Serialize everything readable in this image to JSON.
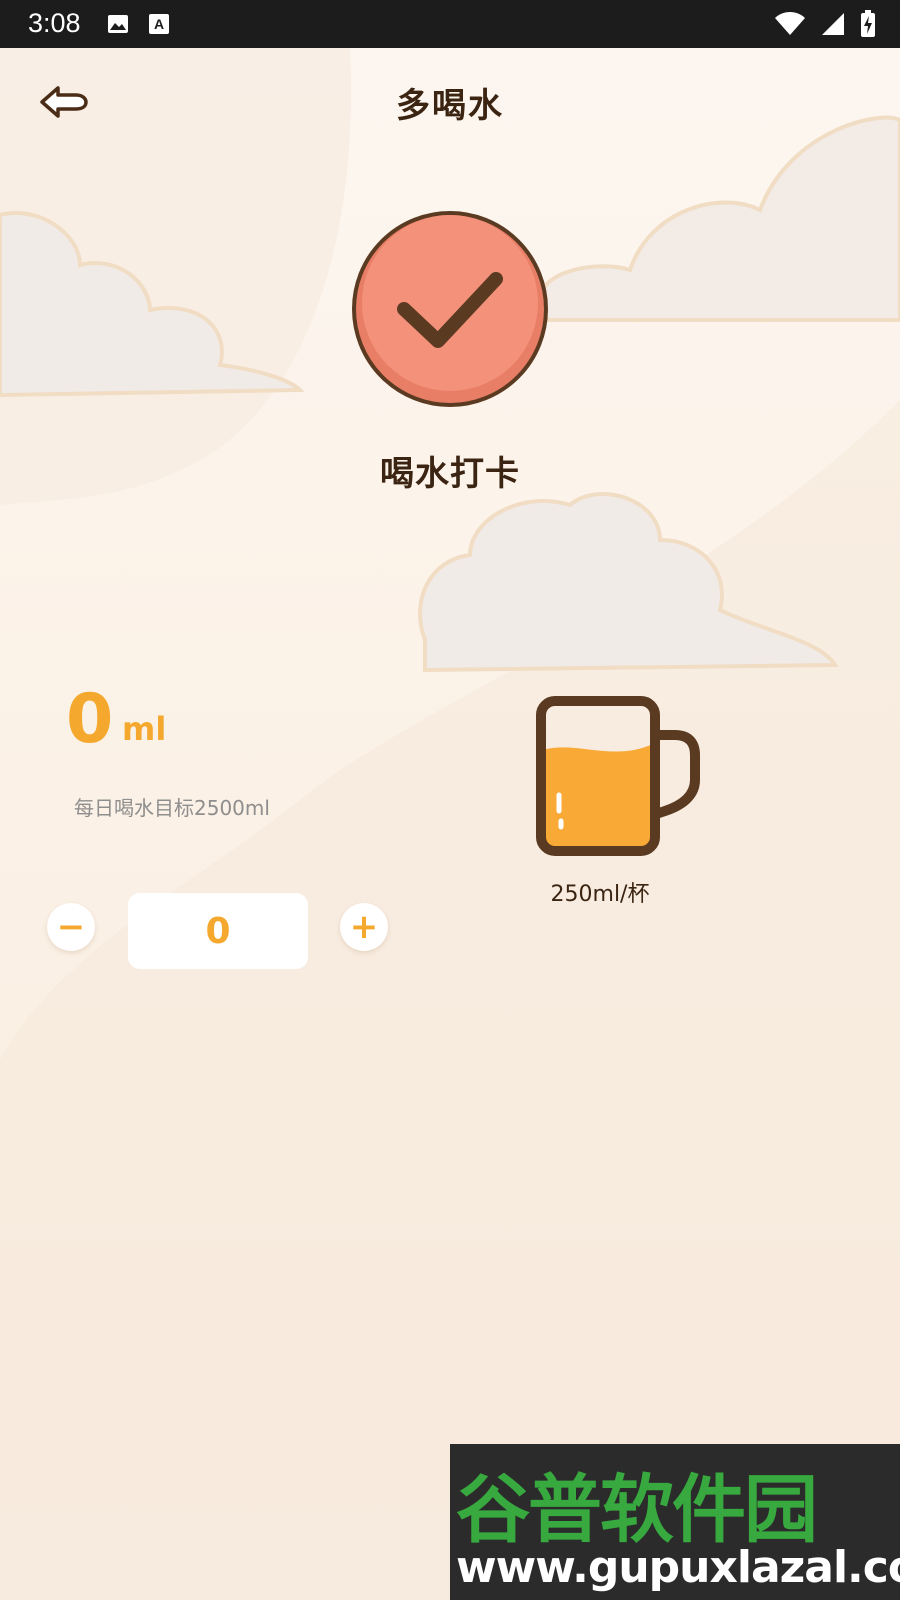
{
  "status_bar": {
    "time": "3:08",
    "left_icons": [
      "image-icon",
      "text-a-icon"
    ],
    "right_icons": [
      "wifi-icon",
      "signal-icon",
      "battery-charging-icon"
    ]
  },
  "header": {
    "title": "多喝水",
    "back_icon": "back-arrow-icon"
  },
  "checkin": {
    "label": "喝水打卡",
    "icon": "check-icon",
    "color": "#f4917a"
  },
  "intake": {
    "amount": "0",
    "unit": "ml",
    "goal_text": "每日喝水目标2500ml"
  },
  "stepper": {
    "minus_label": "−",
    "plus_label": "+",
    "value": "0"
  },
  "mug": {
    "icon": "mug-icon",
    "cup_size": "250ml/杯",
    "fill_color": "#f8a936"
  },
  "watermark": {
    "brand": "谷普软件园",
    "url": "www.gupuxlazal.com"
  },
  "colors": {
    "accent": "#f5a82e",
    "text_dark": "#3b2412",
    "background": "#fbf1e6"
  }
}
